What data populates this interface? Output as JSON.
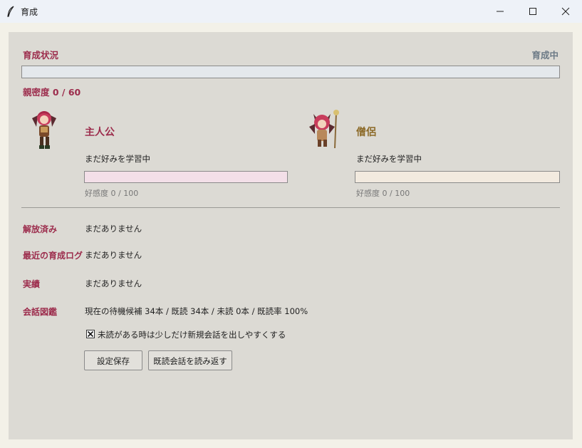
{
  "window": {
    "title": "育成",
    "icon": "quill-icon"
  },
  "status": {
    "label": "育成状況",
    "state": "育成中",
    "progress": 0,
    "intimacy": "親密度 0 / 60"
  },
  "characters": [
    {
      "name": "主人公",
      "preference": "まだ好みを学習中",
      "affection": "好感度 0 / 100",
      "affection_value": 0,
      "bar_color": "#f3dfe8",
      "name_color": "#9c2c4c"
    },
    {
      "name": "僧侶",
      "preference": "まだ好みを学習中",
      "affection": "好感度 0 / 100",
      "affection_value": 0,
      "bar_color": "#f2eadf",
      "name_color": "#8c6a28"
    }
  ],
  "rows": [
    {
      "label": "解放済み",
      "value": "まだありません"
    },
    {
      "label": "最近の育成ログ",
      "value": "まだありません"
    },
    {
      "label": "実績",
      "value": "まだありません"
    },
    {
      "label": "会話図鑑",
      "value": "現在の待機候補 34本 / 既読 34本 / 未読 0本 / 既読率 100%"
    }
  ],
  "option": {
    "label": "未読がある時は少しだけ新規会話を出しやすくする",
    "checked": true
  },
  "buttons": {
    "save": "設定保存",
    "reread": "既読会話を読み返す"
  },
  "colors": {
    "accent_pink": "#9c2c4c",
    "accent_gold": "#8c6a28",
    "status_gray": "#6c7a86"
  }
}
